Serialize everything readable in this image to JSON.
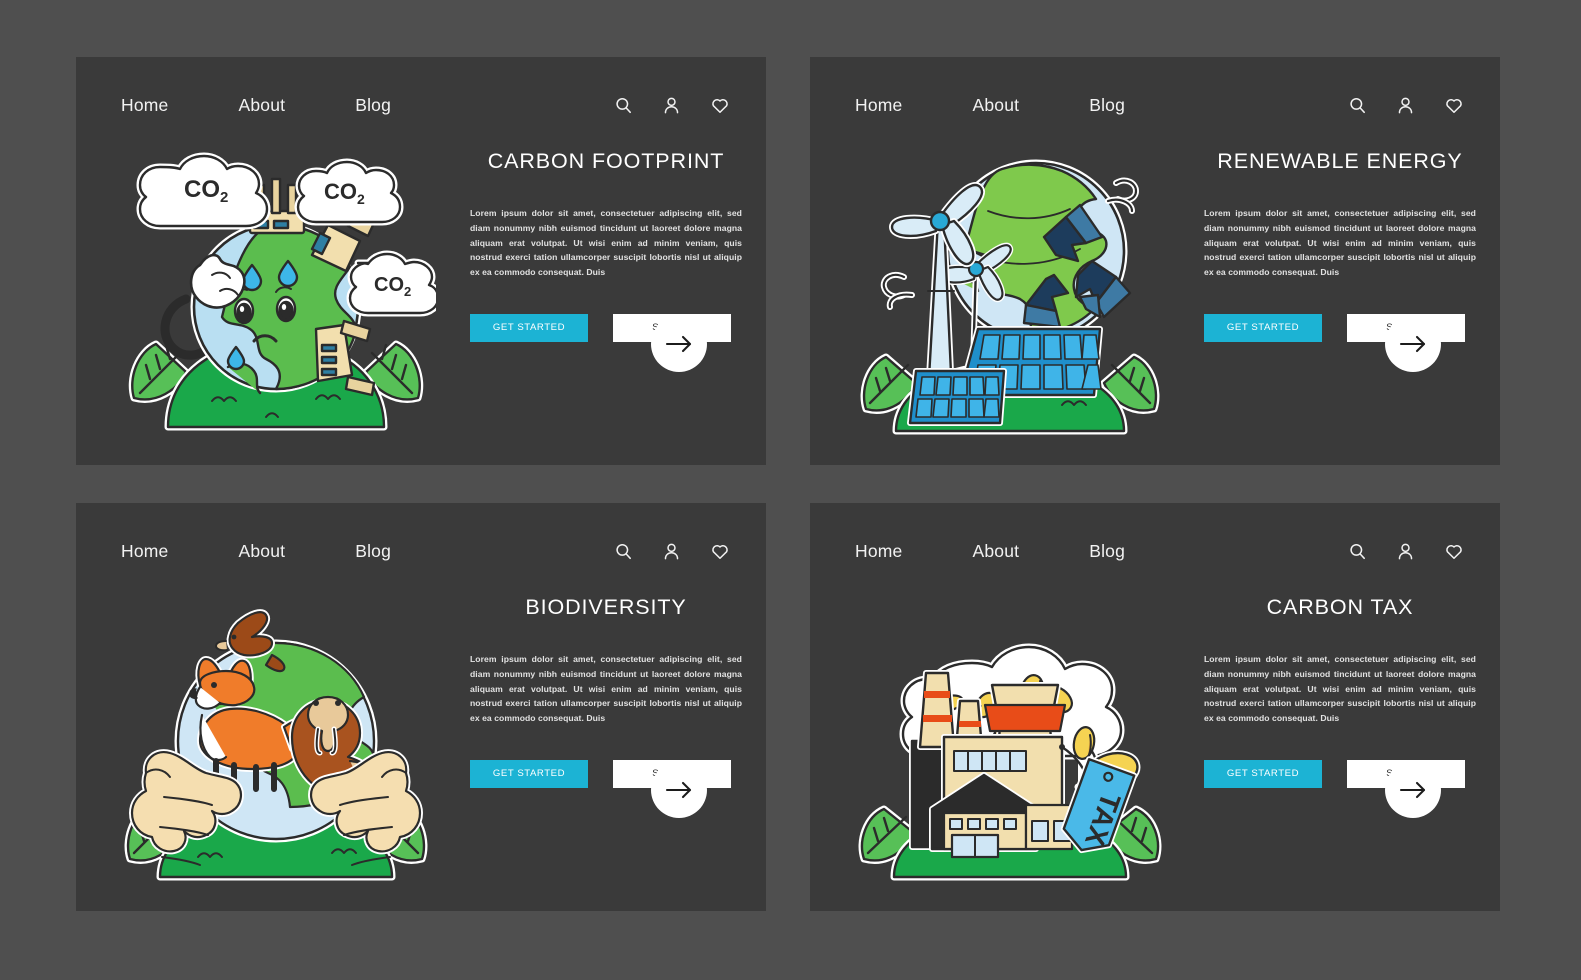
{
  "theme": {
    "page_background": "#4f4f4f",
    "panel_background": "#3a3a3a",
    "accent": "#1cb3d4",
    "text_light": "#ffffff",
    "text_body": "#e2e2e2"
  },
  "nav": {
    "links": [
      "Home",
      "About",
      "Blog"
    ],
    "icons": [
      "search-icon",
      "user-icon",
      "heart-icon"
    ]
  },
  "buttons": {
    "primary_label": "GET STARTED",
    "secondary_label": "SIGN IN",
    "arrow_label": "→"
  },
  "body_text": "Lorem ipsum dolor sit amet, consectetuer adipiscing elit, sed diam nonummy nibh euismod tincidunt ut laoreet dolore magna aliquam erat volutpat. Ut wisi enim ad minim veniam, quis nostrud exerci tation ullamcorper suscipit lobortis nisl ut aliquip ex ea commodo consequat. Duis",
  "panels": [
    {
      "title": "CARBON FOOTPRINT",
      "illustration": "crying-earth-with-co2-factories",
      "illustration_labels": [
        "CO",
        "2"
      ],
      "co2_label": "CO",
      "co2_subscript": "2"
    },
    {
      "title": "RENEWABLE ENERGY",
      "illustration": "wind-turbines-solar-panels-globe-recycle"
    },
    {
      "title": "BIODIVERSITY",
      "illustration": "hands-holding-earth-with-fox-bird-walrus"
    },
    {
      "title": "CARBON TAX",
      "illustration": "factory-with-coin-smoke-and-tax-tag",
      "tag_label": "TAX"
    }
  ]
}
